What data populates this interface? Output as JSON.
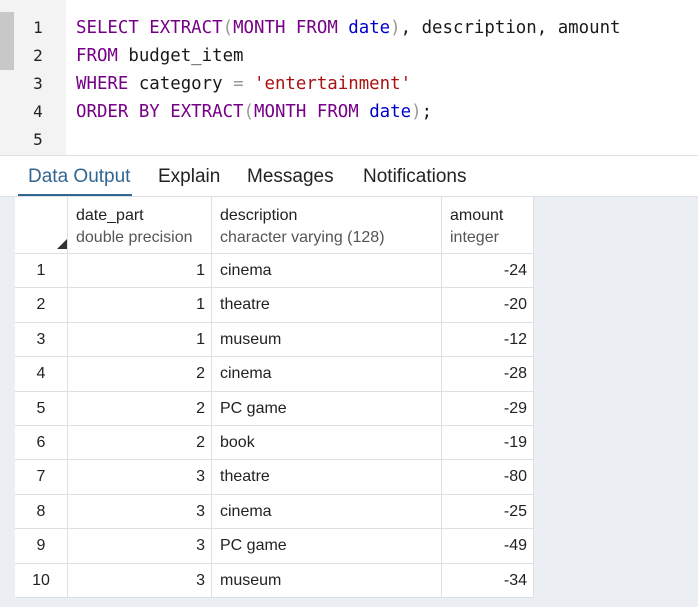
{
  "editor": {
    "lines": [
      {
        "n": "1",
        "tokens": [
          {
            "t": "SELECT ",
            "c": "kw"
          },
          {
            "t": "EXTRACT",
            "c": "fn"
          },
          {
            "t": "(",
            "c": "punc"
          },
          {
            "t": "MONTH ",
            "c": "kw"
          },
          {
            "t": "FROM ",
            "c": "kw"
          },
          {
            "t": "date",
            "c": "var"
          },
          {
            "t": ")",
            "c": "punc"
          },
          {
            "t": ", description, amount",
            "c": "plain"
          }
        ]
      },
      {
        "n": "2",
        "tokens": [
          {
            "t": "FROM ",
            "c": "kw"
          },
          {
            "t": "budget_item",
            "c": "plain"
          }
        ]
      },
      {
        "n": "3",
        "tokens": [
          {
            "t": "WHERE ",
            "c": "kw"
          },
          {
            "t": "category ",
            "c": "plain"
          },
          {
            "t": "= ",
            "c": "punc"
          },
          {
            "t": "'entertainment'",
            "c": "str"
          }
        ]
      },
      {
        "n": "4",
        "tokens": [
          {
            "t": "ORDER BY ",
            "c": "kw"
          },
          {
            "t": "EXTRACT",
            "c": "fn"
          },
          {
            "t": "(",
            "c": "punc"
          },
          {
            "t": "MONTH ",
            "c": "kw"
          },
          {
            "t": "FROM ",
            "c": "kw"
          },
          {
            "t": "date",
            "c": "var"
          },
          {
            "t": ")",
            "c": "punc"
          },
          {
            "t": ";",
            "c": "plain"
          }
        ]
      },
      {
        "n": "5",
        "tokens": []
      }
    ]
  },
  "tabs": {
    "data_output": "Data Output",
    "explain": "Explain",
    "messages": "Messages",
    "notifications": "Notifications",
    "active": "data_output"
  },
  "grid": {
    "columns": [
      {
        "name": "date_part",
        "type": "double precision"
      },
      {
        "name": "description",
        "type": "character varying (128)"
      },
      {
        "name": "amount",
        "type": "integer"
      }
    ],
    "rows": [
      {
        "idx": "1",
        "date_part": "1",
        "description": "cinema",
        "amount": "-24"
      },
      {
        "idx": "2",
        "date_part": "1",
        "description": "theatre",
        "amount": "-20"
      },
      {
        "idx": "3",
        "date_part": "1",
        "description": "museum",
        "amount": "-12"
      },
      {
        "idx": "4",
        "date_part": "2",
        "description": "cinema",
        "amount": "-28"
      },
      {
        "idx": "5",
        "date_part": "2",
        "description": "PC game",
        "amount": "-29"
      },
      {
        "idx": "6",
        "date_part": "2",
        "description": "book",
        "amount": "-19"
      },
      {
        "idx": "7",
        "date_part": "3",
        "description": "theatre",
        "amount": "-80"
      },
      {
        "idx": "8",
        "date_part": "3",
        "description": "cinema",
        "amount": "-25"
      },
      {
        "idx": "9",
        "date_part": "3",
        "description": "PC game",
        "amount": "-49"
      },
      {
        "idx": "10",
        "date_part": "3",
        "description": "museum",
        "amount": "-34"
      }
    ]
  },
  "colors": {
    "keyword": "#770088",
    "variable": "#0000cc",
    "string": "#aa1111",
    "active_tab": "#326690"
  }
}
